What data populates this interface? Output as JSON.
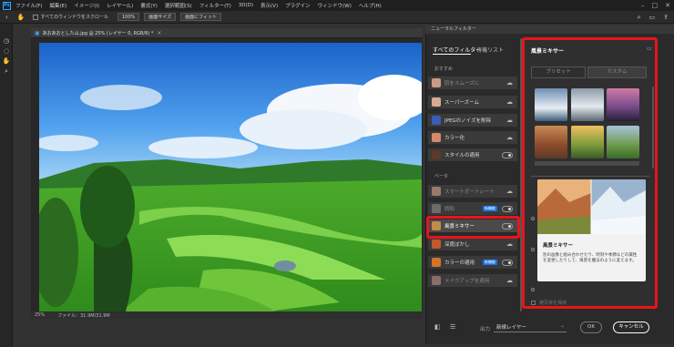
{
  "app": {
    "logo": "Ps"
  },
  "menubar": {
    "items": [
      "ファイル(F)",
      "編集(E)",
      "イメージ(I)",
      "レイヤー(L)",
      "書式(Y)",
      "選択範囲(S)",
      "フィルター(T)",
      "3D(D)",
      "表示(V)",
      "プラグイン",
      "ウィンドウ(W)",
      "ヘルプ(H)"
    ]
  },
  "optionsbar": {
    "scroll_all_label": "すべてのウィンドウをスクロール",
    "zoom_100": "100%",
    "fit_label": "画面サイズ",
    "fill_label": "画面にフィット"
  },
  "document": {
    "tab_title": "あおあおとした山.jpg @ 25% (レイヤー 0, RGB/8) *",
    "zoom": "25%",
    "file_info": "ファイル：31.9M/31.9M"
  },
  "neural_filters": {
    "panel_title": "ニューラルフィルター",
    "tabs": [
      "すべてのフィルター",
      "待機リスト"
    ],
    "featured_header": "おすすめ",
    "featured": [
      {
        "label": "肌をスムーズに",
        "state": "download",
        "dim": true
      },
      {
        "label": "スーパーズーム",
        "state": "download"
      },
      {
        "label": "JPEGのノイズを削除",
        "state": "download"
      },
      {
        "label": "カラー化",
        "state": "download"
      },
      {
        "label": "スタイルの適用",
        "state": "toggle"
      }
    ],
    "beta_header": "ベータ",
    "beta": [
      {
        "label": "スマートポートレート",
        "state": "download",
        "dim": true
      },
      {
        "label": "調和",
        "state": "toggle",
        "badge": "新機能",
        "dim": true
      },
      {
        "label": "風景ミキサー",
        "state": "toggle",
        "selected": true
      },
      {
        "label": "深度ぼかし",
        "state": "download"
      },
      {
        "label": "カラーの適用",
        "state": "toggle",
        "badge": "新機能"
      },
      {
        "label": "メイクアップを適用",
        "state": "download",
        "dim": true
      }
    ],
    "detail": {
      "title": "風景ミキサー",
      "tab_preset": "プリセット",
      "tab_custom": "カスタム",
      "card_title": "風景ミキサー",
      "card_desc": "別の画像と組み合わせたり、時刻や季節などの属性を変更したりして、風景を魔法のように変えます。",
      "preserve_label": "被写体を保持"
    },
    "output_label": "出力",
    "output_value": "新規レイヤー",
    "ok_label": "OK",
    "cancel_label": "キャンセル"
  },
  "colors": {
    "highlight": "#e8141d",
    "badge": "#1473e6"
  }
}
